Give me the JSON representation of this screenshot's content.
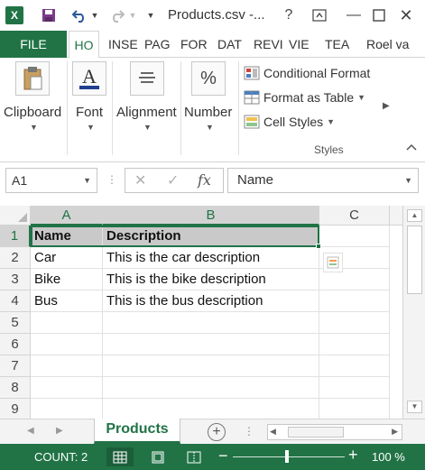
{
  "titlebar": {
    "title": "Products.csv -...",
    "help": "?",
    "minimize": "—",
    "close": "✕"
  },
  "tabs": [
    {
      "label": "FILE"
    },
    {
      "label": "HO"
    },
    {
      "label": "INSE"
    },
    {
      "label": "PAG"
    },
    {
      "label": "FOR"
    },
    {
      "label": "DAT"
    },
    {
      "label": "REVI"
    },
    {
      "label": "VIE"
    },
    {
      "label": "TEA"
    },
    {
      "label": "Roel va"
    }
  ],
  "ribbon": {
    "clipboard": "Clipboard",
    "font": "Font",
    "alignment": "Alignment",
    "number": "Number",
    "number_symbol": "%",
    "font_symbol": "A",
    "conditional_formatting": "Conditional Format",
    "format_as_table": "Format as Table",
    "cell_styles": "Cell Styles",
    "styles_group": "Styles"
  },
  "formula_bar": {
    "name_box": "A1",
    "value": "Name",
    "fx": "fx",
    "cancel": "✕",
    "enter": "✓"
  },
  "grid": {
    "columns": [
      "A",
      "B",
      "C"
    ],
    "row_numbers": [
      "1",
      "2",
      "3",
      "4",
      "5",
      "6",
      "7",
      "8",
      "9"
    ],
    "rows": [
      [
        "Name",
        "Description"
      ],
      [
        "Car",
        "This is the car description"
      ],
      [
        "Bike",
        "This is the bike description"
      ],
      [
        "Bus",
        "This is the bus description"
      ]
    ]
  },
  "sheets": {
    "active": "Products",
    "add": "+",
    "dots": "⋮"
  },
  "status": {
    "count": "COUNT: 2",
    "zoom_minus": "−",
    "zoom_plus": "+",
    "zoom_level": "100 %",
    "zoom_percent": 100
  },
  "colors": {
    "accent": "#217346",
    "header_fill": "#c9c9c9"
  }
}
